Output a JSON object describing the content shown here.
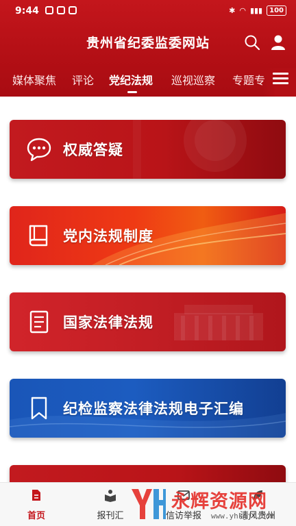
{
  "status_bar": {
    "time": "9:44",
    "battery": "100"
  },
  "header": {
    "title": "贵州省纪委监委网站",
    "search_icon": "search-icon",
    "user_icon": "user-icon"
  },
  "tabs": [
    {
      "label": "媒体聚焦",
      "active": false
    },
    {
      "label": "评论",
      "active": false
    },
    {
      "label": "党纪法规",
      "active": true
    },
    {
      "label": "巡视巡察",
      "active": false
    },
    {
      "label": "专题专",
      "active": false
    }
  ],
  "cards": [
    {
      "label": "权威答疑",
      "icon": "chat-bubble-icon"
    },
    {
      "label": "党内法规制度",
      "icon": "book-icon"
    },
    {
      "label": "国家法律法规",
      "icon": "document-icon"
    },
    {
      "label": "纪检监察法律法规电子汇编",
      "icon": "bookmark-icon"
    }
  ],
  "bottom_nav": [
    {
      "label": "首页",
      "icon": "home-document-icon",
      "active": true
    },
    {
      "label": "报刊汇",
      "icon": "newspaper-icon",
      "active": false
    },
    {
      "label": "信访举报",
      "icon": "mail-icon",
      "active": false
    },
    {
      "label": "清风贵州",
      "icon": "leaf-icon",
      "active": false
    }
  ],
  "watermark": {
    "title": "永辉资源网",
    "url": "www.yhkjjf.com"
  },
  "colors": {
    "brand_red": "#c4161c",
    "card_blue": "#1a56b8",
    "white": "#ffffff"
  }
}
